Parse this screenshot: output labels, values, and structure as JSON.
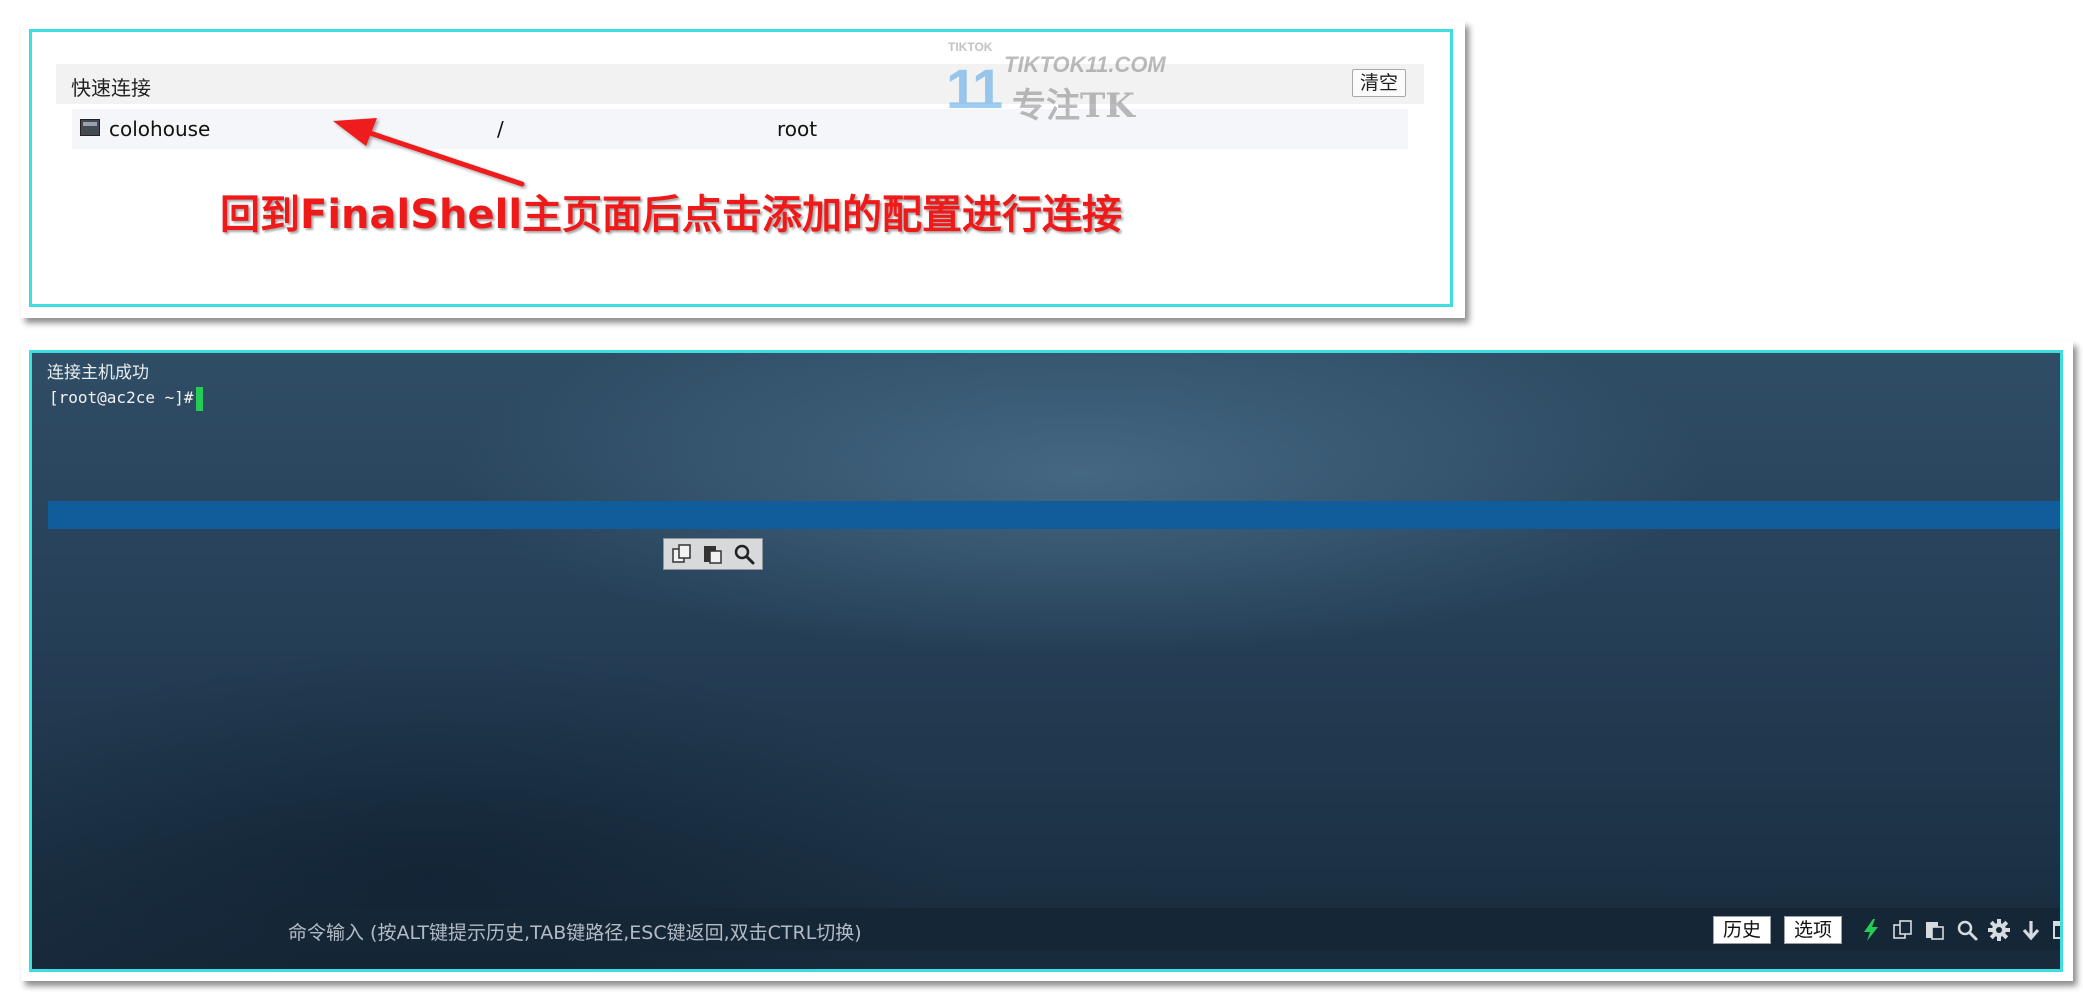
{
  "quick_connect": {
    "title": "快速连接",
    "clear_label": "清空",
    "rows": [
      {
        "name": "colohouse",
        "path": "/",
        "user": "root",
        "icon": "terminal-icon"
      }
    ]
  },
  "annotation": {
    "text": "回到FinalShell主页面后点击添加的配置进行连接",
    "color": "#ee1a1a"
  },
  "watermark": {
    "small": "TIKTOK",
    "digits": "11",
    "url": "TIKTOK11.COM",
    "tagline": "专注TK"
  },
  "terminal": {
    "status_text": "连接主机成功",
    "prompt": "[root@ac2ce ~]#",
    "cursor_color": "#22cc55",
    "highlight_color": "#115c9a",
    "float_tools": [
      "copy-icon",
      "paste-icon",
      "search-icon"
    ]
  },
  "command_bar": {
    "placeholder": "命令输入 (按ALT键提示历史,TAB键路径,ESC键返回,双击CTRL切换)",
    "history_label": "历史",
    "options_label": "选项",
    "icons": [
      "lightning-icon",
      "copy-icon",
      "paste-icon",
      "search-icon",
      "gear-icon",
      "arrow-down-icon",
      "window-icon"
    ]
  },
  "colors": {
    "panel_border": "#3ddde0",
    "terminal_bg": "#27425a"
  }
}
